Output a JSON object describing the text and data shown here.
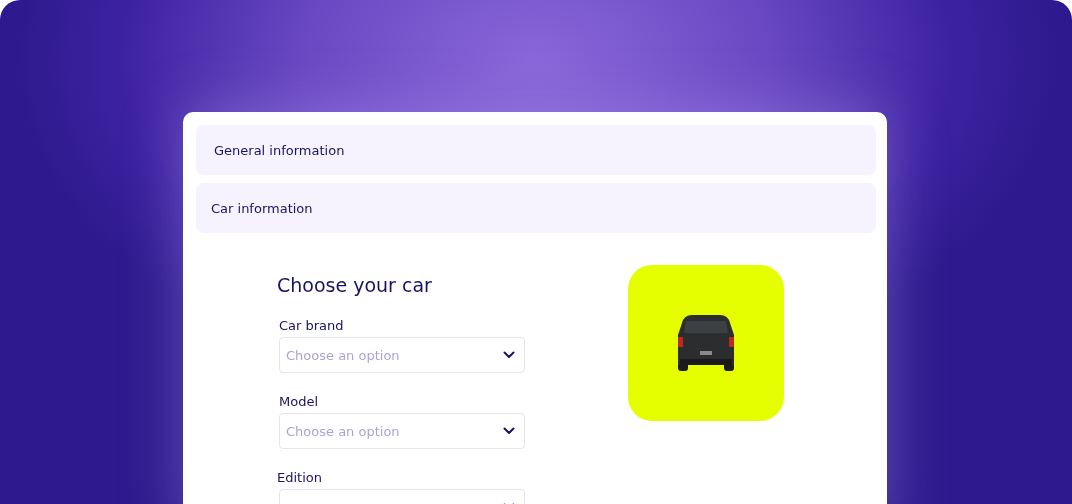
{
  "sections": [
    {
      "title": "General information"
    },
    {
      "title": "Car information"
    }
  ],
  "form": {
    "heading": "Choose your car",
    "fields": [
      {
        "label": "Car brand",
        "placeholder": "Choose an option"
      },
      {
        "label": "Model",
        "placeholder": "Choose an option"
      },
      {
        "label": "Edition"
      }
    ]
  }
}
